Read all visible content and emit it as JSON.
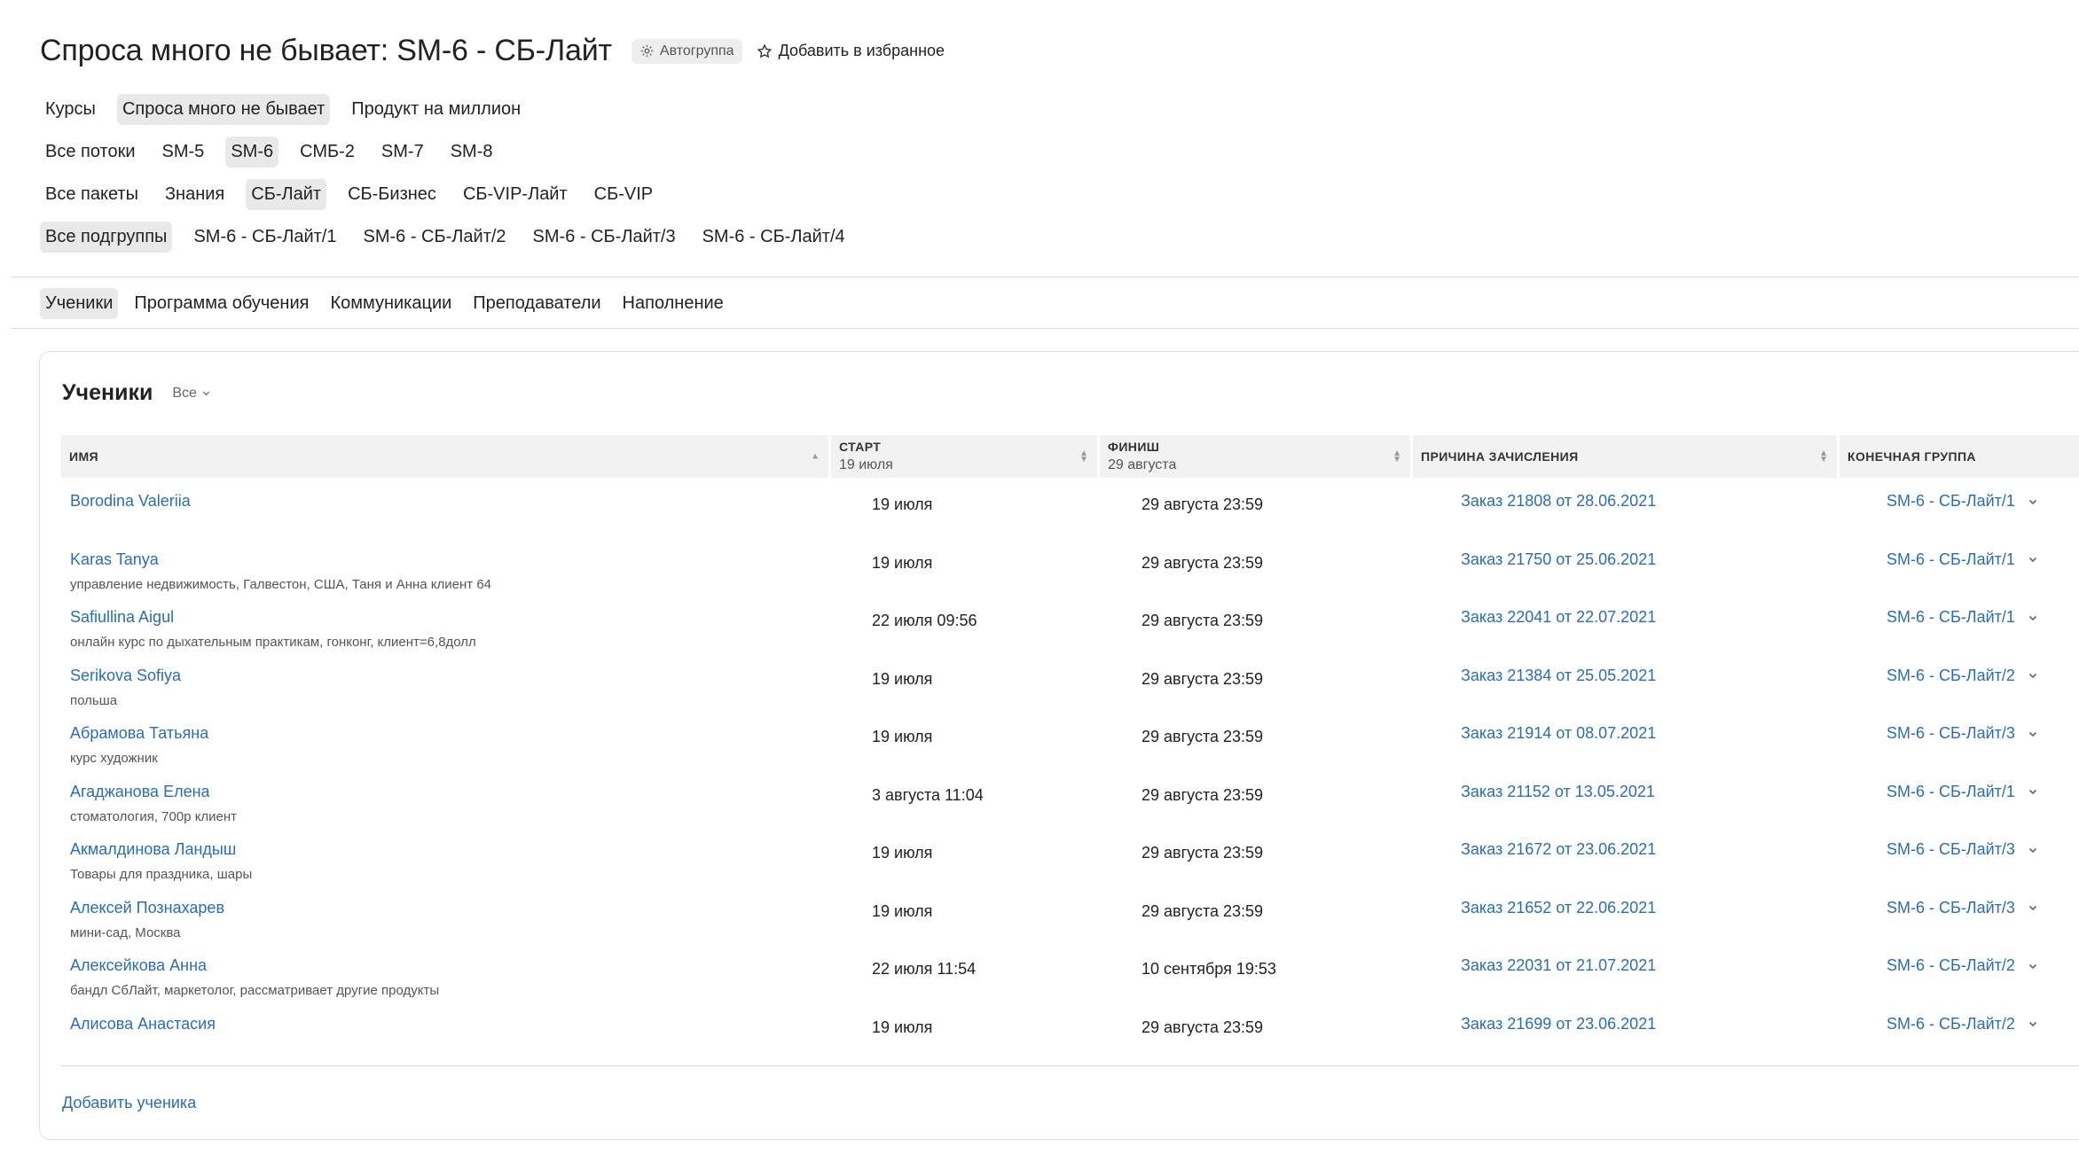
{
  "header": {
    "title": "Спроса много не бывает: SM-6 - СБ-Лайт",
    "autogroup_label": "Автогруппа",
    "favorite_label": "Добавить в избранное"
  },
  "filters": {
    "products": [
      {
        "label": "Курсы",
        "active": false
      },
      {
        "label": "Спроса много не бывает",
        "active": true
      },
      {
        "label": "Продукт на миллион",
        "active": false
      }
    ],
    "streams": [
      {
        "label": "Все потоки",
        "active": false
      },
      {
        "label": "SM-5",
        "active": false
      },
      {
        "label": "SM-6",
        "active": true
      },
      {
        "label": "СМБ-2",
        "active": false
      },
      {
        "label": "SM-7",
        "active": false
      },
      {
        "label": "SM-8",
        "active": false
      }
    ],
    "packages": [
      {
        "label": "Все пакеты",
        "active": false
      },
      {
        "label": "Знания",
        "active": false
      },
      {
        "label": "СБ-Лайт",
        "active": true
      },
      {
        "label": "СБ-Бизнес",
        "active": false
      },
      {
        "label": "СБ-VIP-Лайт",
        "active": false
      },
      {
        "label": "СБ-VIP",
        "active": false
      }
    ],
    "subgroups": [
      {
        "label": "Все подгруппы",
        "active": true
      },
      {
        "label": "SM-6 - СБ-Лайт/1",
        "active": false
      },
      {
        "label": "SM-6 - СБ-Лайт/2",
        "active": false
      },
      {
        "label": "SM-6 - СБ-Лайт/3",
        "active": false
      },
      {
        "label": "SM-6 - СБ-Лайт/4",
        "active": false
      }
    ]
  },
  "tabs": [
    {
      "label": "Ученики",
      "active": true
    },
    {
      "label": "Программа обучения",
      "active": false
    },
    {
      "label": "Коммуникации",
      "active": false
    },
    {
      "label": "Преподаватели",
      "active": false
    },
    {
      "label": "Наполнение",
      "active": false
    }
  ],
  "students_card": {
    "title": "Ученики",
    "filter_value": "Все",
    "columns": {
      "name": {
        "label": "Имя"
      },
      "start": {
        "label": "Старт",
        "sub": "19 июля"
      },
      "finish": {
        "label": "Финиш",
        "sub": "29 августа"
      },
      "reason": {
        "label": "Причина зачисления"
      },
      "group": {
        "label": "Конечная группа"
      }
    },
    "rows": [
      {
        "name": "Borodina Valeriia",
        "note": "",
        "start": "19 июля",
        "finish": "29 августа 23:59",
        "reason": "Заказ 21808 от 28.06.2021",
        "group": "SM-6 - СБ-Лайт/1"
      },
      {
        "name": "Karas Tanya",
        "note": "управление недвижимость, Галвестон, США, Таня и Анна клиент 64",
        "start": "19 июля",
        "finish": "29 августа 23:59",
        "reason": "Заказ 21750 от 25.06.2021",
        "group": "SM-6 - СБ-Лайт/1"
      },
      {
        "name": "Safiullina Aigul",
        "note": "онлайн курс по дыхательным практикам, гонконг, клиент=6,8долл",
        "start": "22 июля 09:56",
        "finish": "29 августа 23:59",
        "reason": "Заказ 22041 от 22.07.2021",
        "group": "SM-6 - СБ-Лайт/1"
      },
      {
        "name": "Serikova Sofiya",
        "note": "польша",
        "start": "19 июля",
        "finish": "29 августа 23:59",
        "reason": "Заказ 21384 от 25.05.2021",
        "group": "SM-6 - СБ-Лайт/2"
      },
      {
        "name": "Абрамова Татьяна",
        "note": "курс художник",
        "start": "19 июля",
        "finish": "29 августа 23:59",
        "reason": "Заказ 21914 от 08.07.2021",
        "group": "SM-6 - СБ-Лайт/3"
      },
      {
        "name": "Агаджанова Елена",
        "note": "стоматология, 700р клиент",
        "start": "3 августа 11:04",
        "finish": "29 августа 23:59",
        "reason": "Заказ 21152 от 13.05.2021",
        "group": "SM-6 - СБ-Лайт/1"
      },
      {
        "name": "Акмалдинова Ландыш",
        "note": "Товары для праздника, шары",
        "start": "19 июля",
        "finish": "29 августа 23:59",
        "reason": "Заказ 21672 от 23.06.2021",
        "group": "SM-6 - СБ-Лайт/3"
      },
      {
        "name": "Алексей Познахарев",
        "note": "мини-сад, Москва",
        "start": "19 июля",
        "finish": "29 августа 23:59",
        "reason": "Заказ 21652 от 22.06.2021",
        "group": "SM-6 - СБ-Лайт/3"
      },
      {
        "name": "Алексейкова Анна",
        "note": "бандл СбЛайт, маркетолог, рассматривает другие продукты",
        "start": "22 июля 11:54",
        "finish": "10 сентября 19:53",
        "reason": "Заказ 22031 от 21.07.2021",
        "group": "SM-6 - СБ-Лайт/2"
      },
      {
        "name": "Алисова Анастасия",
        "note": "",
        "start": "19 июля",
        "finish": "29 августа 23:59",
        "reason": "Заказ 21699 от 23.06.2021",
        "group": "SM-6 - СБ-Лайт/2"
      }
    ],
    "add_label": "Добавить ученика"
  },
  "colors": {
    "link": "#2a6db5",
    "active_chip_bg": "#e9e9e9",
    "header_bg": "#f2f2f2"
  },
  "icons": {
    "autogroup": "gear-icon",
    "favorite": "star-icon",
    "sort": "sort-arrows-icon",
    "dropdown": "chevron-down-icon"
  }
}
